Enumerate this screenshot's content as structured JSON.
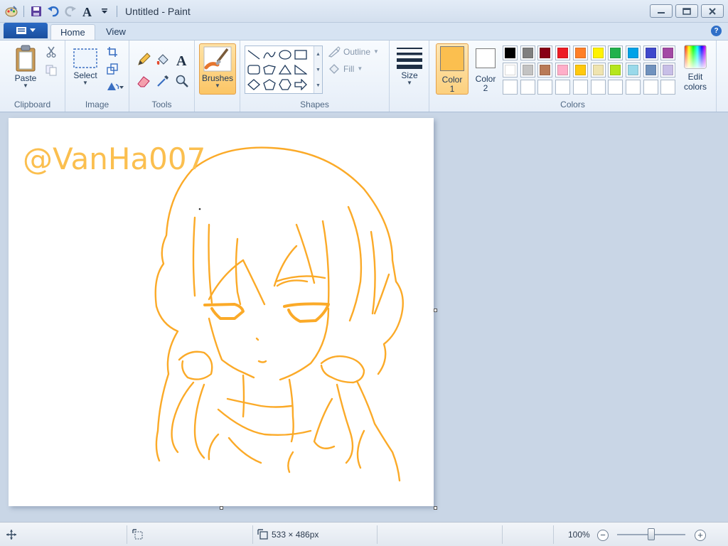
{
  "window": {
    "title": "Untitled - Paint"
  },
  "tabs": [
    {
      "label": "Home"
    },
    {
      "label": "View"
    }
  ],
  "clipboard": {
    "paste_label": "Paste",
    "group_label": "Clipboard"
  },
  "image": {
    "select_label": "Select",
    "group_label": "Image"
  },
  "tools": {
    "group_label": "Tools"
  },
  "brushes": {
    "label": "Brushes"
  },
  "shapes": {
    "outline_label": "Outline",
    "fill_label": "Fill",
    "group_label": "Shapes"
  },
  "size": {
    "label": "Size"
  },
  "colors": {
    "color1_label": "Color",
    "color1_num": "1",
    "color2_label": "Color",
    "color2_num": "2",
    "color1_value": "#fbbf4f",
    "color2_value": "#ffffff",
    "edit_label": "Edit",
    "edit_label2": "colors",
    "group_label": "Colors",
    "palette_row1": [
      "#000000",
      "#7f7f7f",
      "#880015",
      "#ed1c24",
      "#ff7f27",
      "#fff200",
      "#22b14c",
      "#00a2e8",
      "#3f48cc",
      "#a349a4"
    ],
    "palette_row2": [
      "#ffffff",
      "#c3c3c3",
      "#b97a57",
      "#ffaec9",
      "#ffc90e",
      "#efe4b0",
      "#b5e61d",
      "#99d9ea",
      "#7092be",
      "#c8bfe7"
    ]
  },
  "canvas": {
    "watermark": "@VanHa007",
    "stroke_color": "#fbaa28"
  },
  "status": {
    "dimensions": "533 × 486px",
    "zoom": "100%",
    "zoom_fraction": 0.5
  }
}
